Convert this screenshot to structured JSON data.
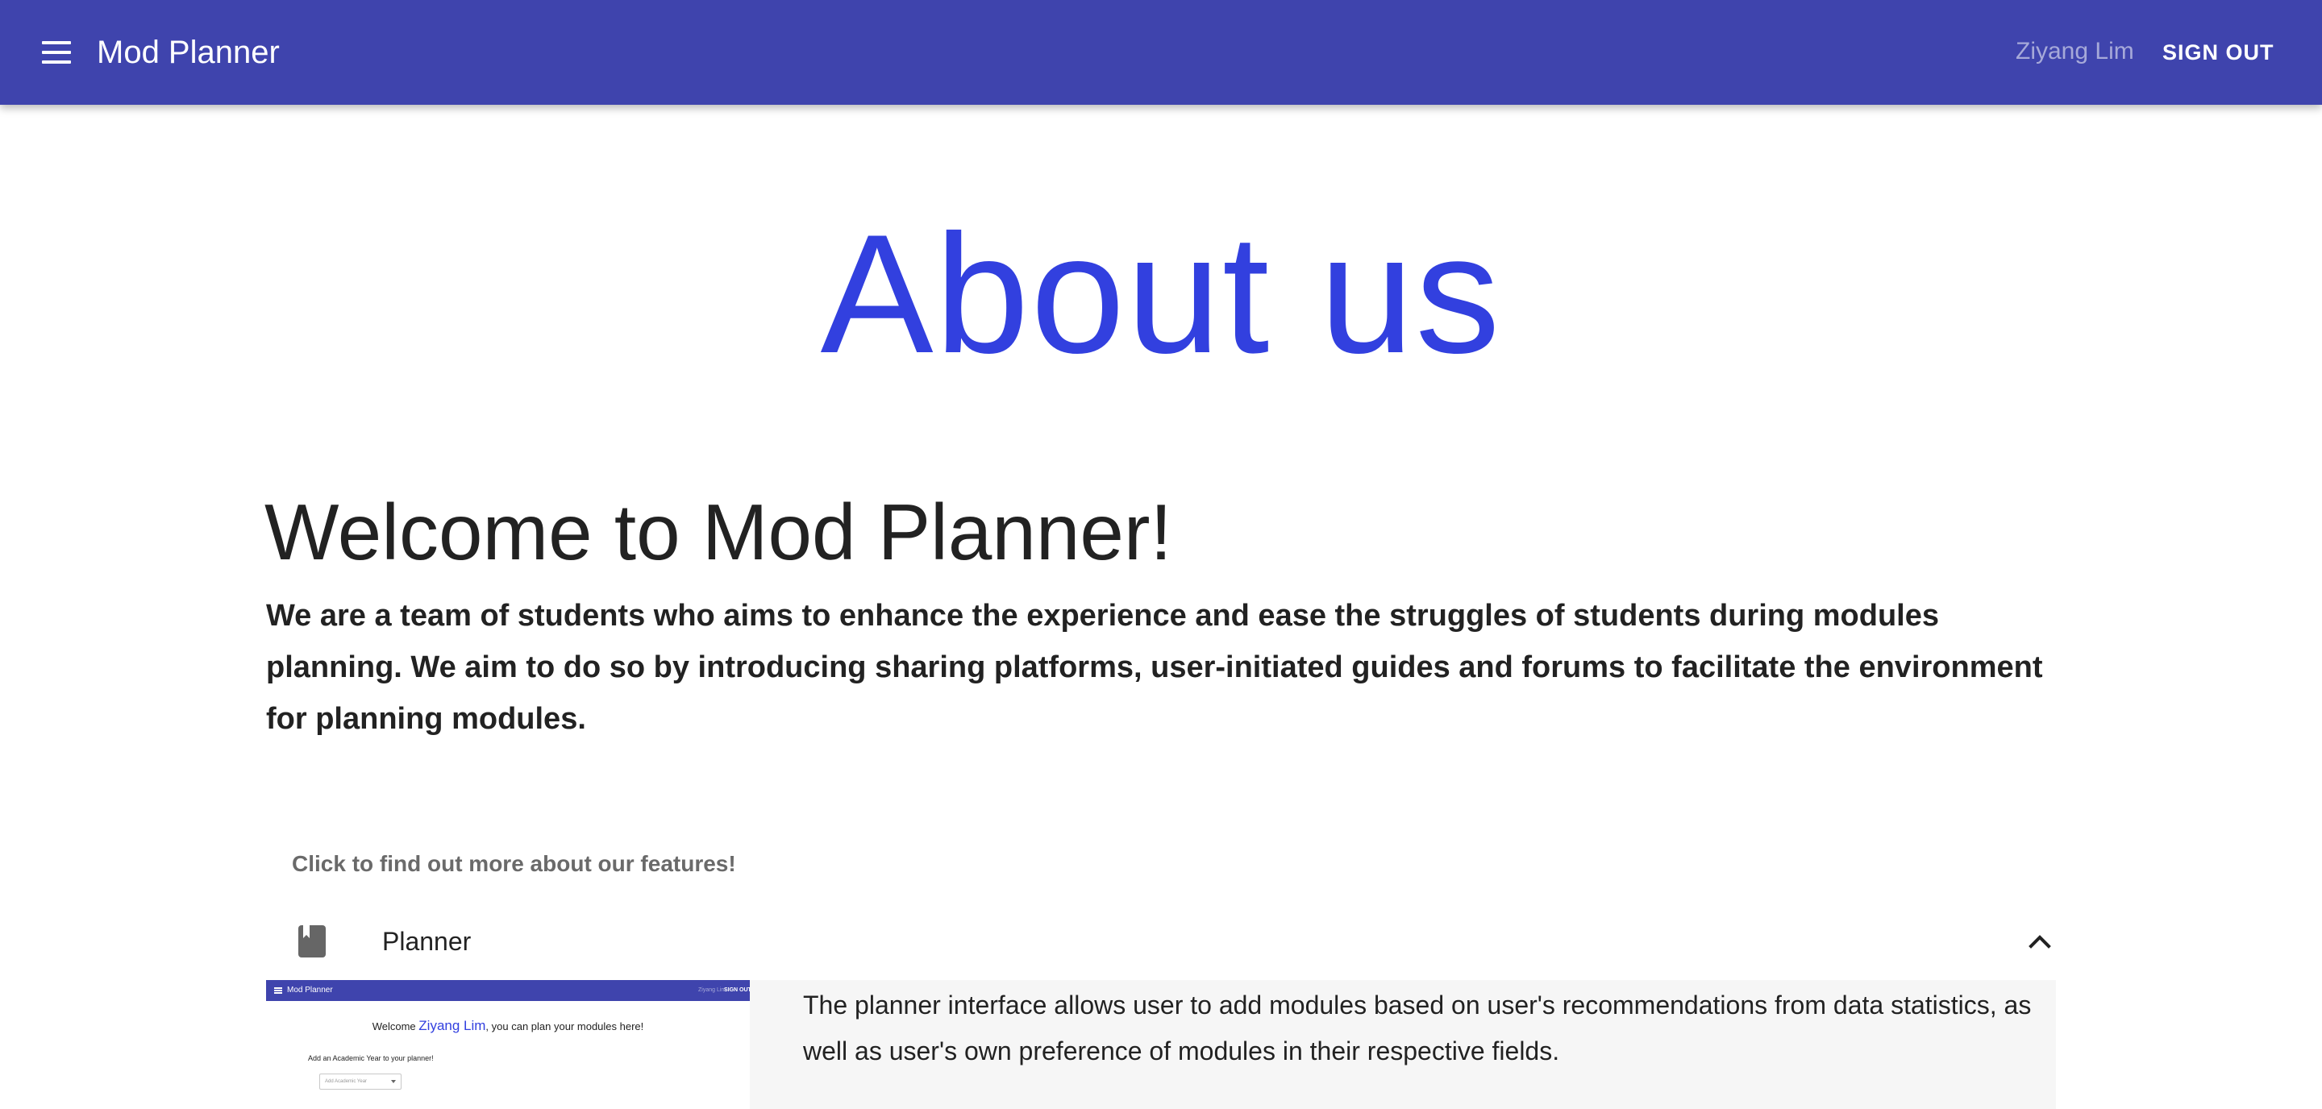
{
  "appbar": {
    "title": "Mod Planner",
    "user_name": "Ziyang Lim",
    "signout_label": "SIGN OUT",
    "menu_icon": "menu-icon",
    "bg_color": "#3f44ad"
  },
  "hero": {
    "title": "About us",
    "color": "#3240df"
  },
  "welcome": {
    "heading": "Welcome to Mod Planner!",
    "intro": "We are a team of students who aims to enhance the experience and ease the struggles of students during modules planning. We aim to do so by introducing sharing platforms, user-initiated guides and forums to facilitate the environment for planning modules."
  },
  "features": {
    "hint": "Click to find out more about our features!",
    "items": [
      {
        "title": "Planner",
        "icon": "book-icon",
        "expanded": true,
        "expand_icon": "chevron-up-icon",
        "description": "The planner interface allows user to add modules based on user's recommendations from data statistics, as well as user's own preference of modules in their respective fields.",
        "preview": {
          "app_title": "Mod Planner",
          "user_name": "Ziyang Lim",
          "signout_label": "SIGN OUT",
          "welcome_prefix": "Welcome ",
          "welcome_name": "Ziyang Lim",
          "welcome_suffix": ", you can plan your modules here!",
          "add_label": "Add an Academic Year to your planner!",
          "select_placeholder": "Add Academic Year"
        }
      }
    ]
  }
}
